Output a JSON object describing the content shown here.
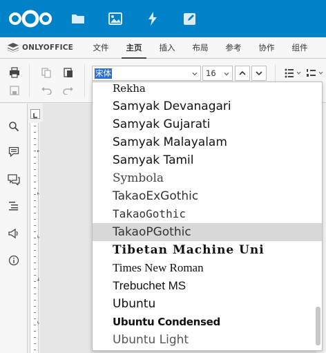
{
  "nextcloud": {
    "apps": [
      "files-icon",
      "photos-icon",
      "activity-icon",
      "notes-icon"
    ]
  },
  "onlyoffice": {
    "logo_text": "ONLYOFFICE",
    "tabs": [
      {
        "label": "文件",
        "active": false
      },
      {
        "label": "主页",
        "active": true
      },
      {
        "label": "插入",
        "active": false
      },
      {
        "label": "布局",
        "active": false
      },
      {
        "label": "参考",
        "active": false
      },
      {
        "label": "协作",
        "active": false
      },
      {
        "label": "组件",
        "active": false
      }
    ]
  },
  "toolbar": {
    "font_name": "宋体",
    "font_size": "16"
  },
  "font_list": {
    "items": [
      {
        "label": "Rekha",
        "selected": false
      },
      {
        "label": "Samyak Devanagari",
        "selected": false
      },
      {
        "label": "Samyak Gujarati",
        "selected": false
      },
      {
        "label": "Samyak Malayalam",
        "selected": false
      },
      {
        "label": "Samyak Tamil",
        "selected": false
      },
      {
        "label": "Symbola",
        "selected": false
      },
      {
        "label": "TakaoExGothic",
        "selected": false
      },
      {
        "label": "TakaoGothic",
        "selected": false
      },
      {
        "label": "TakaoPGothic",
        "selected": true
      },
      {
        "label": "Tibetan Machine Uni",
        "selected": false
      },
      {
        "label": "Times New Roman",
        "selected": false
      },
      {
        "label": "Trebuchet MS",
        "selected": false
      },
      {
        "label": "Ubuntu",
        "selected": false
      },
      {
        "label": "Ubuntu Condensed",
        "selected": false
      },
      {
        "label": "Ubuntu Light",
        "selected": false
      }
    ]
  },
  "ruler": {
    "marks": [
      "1",
      "2",
      "3",
      "4",
      "5"
    ]
  },
  "colors": {
    "nextcloud_blue": "#0082c9",
    "selection_blue": "#2a6fd6",
    "hover_gray": "#d8d8d8"
  }
}
